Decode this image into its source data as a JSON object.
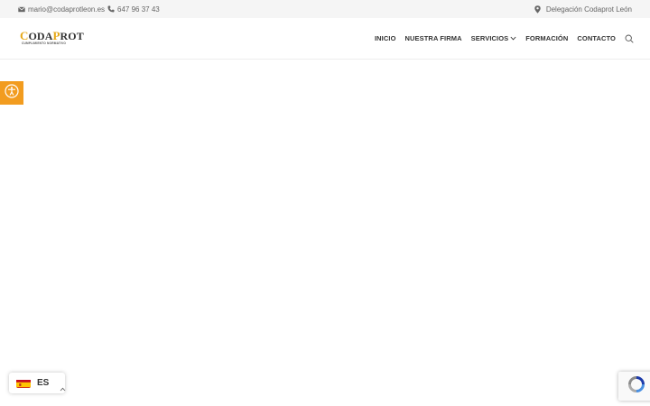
{
  "topbar": {
    "email": "mario@codaprotleon.es",
    "phone": "647 96 37 43",
    "location": "Delegación Codaprot León",
    "icons": {
      "email": "envelope-icon",
      "phone": "phone-icon",
      "location": "map-pin-icon"
    }
  },
  "header": {
    "logo": {
      "part1_first": "C",
      "part1_rest": "ODA",
      "part2_first": "P",
      "part2_rest": "ROT",
      "tagline": "CUMPLIMIENTO NORMATIVO"
    },
    "nav": {
      "inicio": "INICIO",
      "nuestra_firma": "NUESTRA FIRMA",
      "servicios": "SERVICIOS",
      "formacion": "FORMACIÓN",
      "contacto": "CONTACTO"
    }
  },
  "language": {
    "code": "ES"
  },
  "colors": {
    "accent": "#f29c1f",
    "logo_gold": "#e6a817",
    "topbar_bg": "#f5f5f5"
  }
}
